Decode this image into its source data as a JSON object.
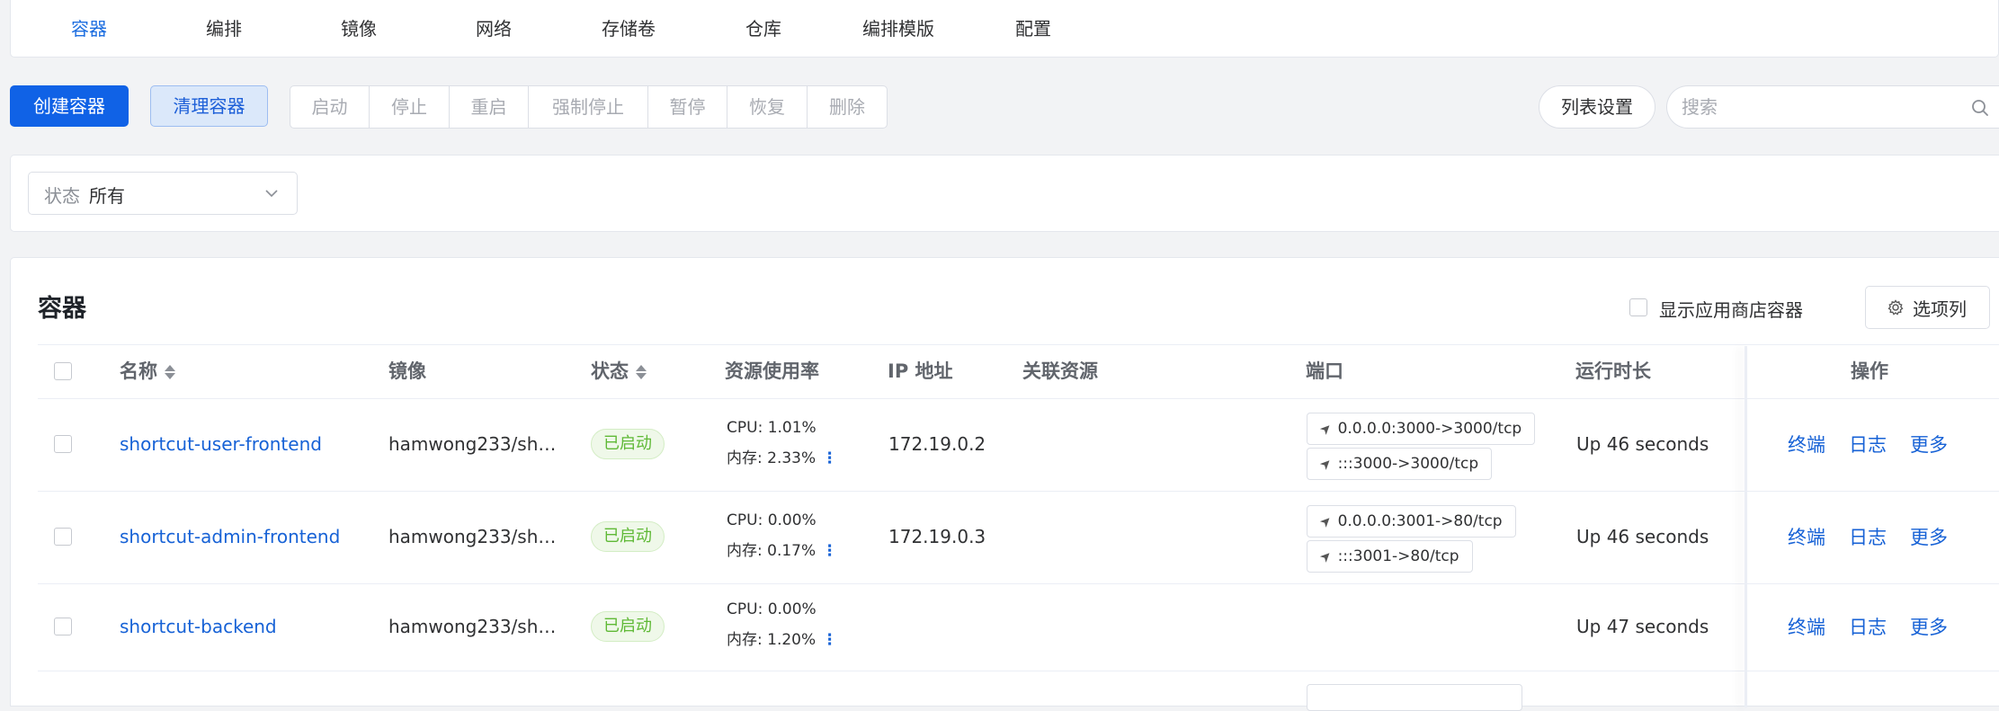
{
  "nav": {
    "items": [
      "容器",
      "编排",
      "镜像",
      "网络",
      "存储卷",
      "仓库",
      "编排模版",
      "配置"
    ]
  },
  "toolbar": {
    "create": "创建容器",
    "clean": "清理容器",
    "group": [
      "启动",
      "停止",
      "重启",
      "强制停止",
      "暂停",
      "恢复",
      "删除"
    ],
    "list_settings": "列表设置",
    "search_placeholder": "搜索"
  },
  "filter": {
    "label": "状态",
    "value": "所有"
  },
  "table": {
    "title": "容器",
    "show_store_label": "显示应用商店容器",
    "columns_button": "选项列",
    "headers": {
      "name": "名称",
      "image": "镜像",
      "status": "状态",
      "usage": "资源使用率",
      "ip": "IP 地址",
      "related": "关联资源",
      "ports": "端口",
      "uptime": "运行时长",
      "ops": "操作"
    },
    "rows": [
      {
        "name": "shortcut-user-frontend",
        "image": "hamwong233/sh…",
        "status": "已启动",
        "cpu": "CPU: 1.01%",
        "mem": "内存: 2.33%",
        "ip": "172.19.0.2",
        "ports": [
          "0.0.0.0:3000->3000/tcp",
          ":::3000->3000/tcp"
        ],
        "uptime": "Up 46 seconds"
      },
      {
        "name": "shortcut-admin-frontend",
        "image": "hamwong233/sh…",
        "status": "已启动",
        "cpu": "CPU: 0.00%",
        "mem": "内存: 0.17%",
        "ip": "172.19.0.3",
        "ports": [
          "0.0.0.0:3001->80/tcp",
          ":::3001->80/tcp"
        ],
        "uptime": "Up 46 seconds"
      },
      {
        "name": "shortcut-backend",
        "image": "hamwong233/sh…",
        "status": "已启动",
        "cpu": "CPU: 0.00%",
        "mem": "内存: 1.20%",
        "ip": "",
        "ports": [],
        "uptime": "Up 47 seconds"
      }
    ],
    "ops": {
      "terminal": "终端",
      "log": "日志",
      "more": "更多"
    },
    "kebab_glyph": "⋮",
    "port_glyph": "➤"
  },
  "colors": {
    "primary": "#1062e6",
    "link": "#1762d6",
    "success": "#5fb936"
  }
}
